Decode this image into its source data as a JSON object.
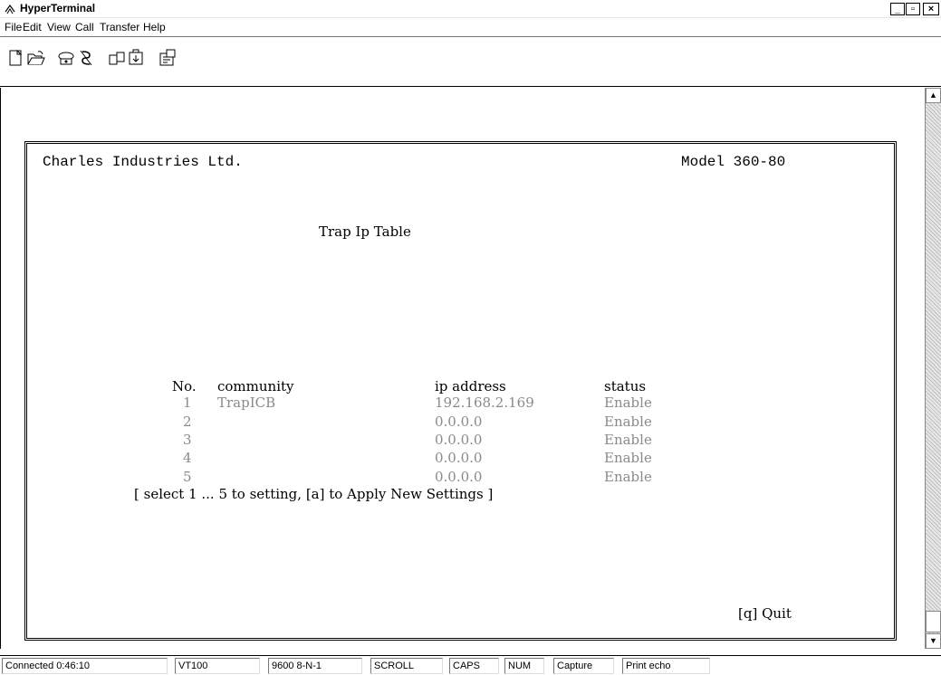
{
  "window": {
    "title": "HyperTerminal",
    "controls": {
      "minimize": "_",
      "maximize": "▫",
      "close": "×"
    }
  },
  "menu": [
    "File",
    "Edit",
    "View",
    "Call",
    "Transfer",
    "Help"
  ],
  "toolbar": {
    "icons": [
      "new-connection-icon",
      "open-icon",
      "connect-icon",
      "disconnect-icon",
      "send-icon",
      "receive-icon",
      "properties-icon"
    ]
  },
  "terminal": {
    "company": "Charles Industries Ltd.",
    "model": "Model 360-80",
    "screen_title": "Trap Ip Table",
    "columns": {
      "no": "No.",
      "community": "community",
      "ip": "ip address",
      "status": "status"
    },
    "rows": [
      {
        "no": "1",
        "community": "TrapICB",
        "ip": "192.168.2.169",
        "status": "Enable"
      },
      {
        "no": "2",
        "community": "",
        "ip": "0.0.0.0",
        "status": "Enable"
      },
      {
        "no": "3",
        "community": "",
        "ip": "0.0.0.0",
        "status": "Enable"
      },
      {
        "no": "4",
        "community": "",
        "ip": "0.0.0.0",
        "status": "Enable"
      },
      {
        "no": "5",
        "community": "",
        "ip": "0.0.0.0",
        "status": "Enable"
      }
    ],
    "instructions": "[ select 1 ... 5 to setting, [a] to Apply New Settings ]",
    "quit": "[q] Quit"
  },
  "statusbar": {
    "connected": "Connected 0:46:10",
    "emulation": "VT100",
    "settings": "9600 8-N-1",
    "scroll": "SCROLL",
    "caps": "CAPS",
    "num": "NUM",
    "capture": "Capture",
    "print_echo": "Print echo"
  },
  "colors": {
    "dim_text": "#8a8a8a",
    "text": "#000000",
    "background": "#ffffff"
  }
}
